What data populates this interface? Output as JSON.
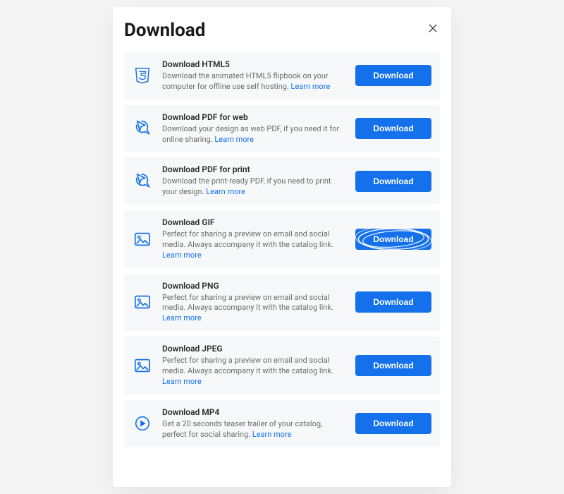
{
  "modal": {
    "title": "Download",
    "options": [
      {
        "icon": "html5-icon",
        "title": "Download HTML5",
        "desc": "Download the animated HTML5 flipbook on your computer for offline use self hosting.",
        "learn": "Learn more",
        "button": "Download",
        "highlight": false
      },
      {
        "icon": "pdf-icon",
        "title": "Download PDF for web",
        "desc": "Download your design as web PDF, if you need it for online sharing.",
        "learn": "Learn more",
        "button": "Download",
        "highlight": false
      },
      {
        "icon": "pdf-icon",
        "title": "Download PDF for print",
        "desc": "Download the print-ready PDF, if you need to print your design.",
        "learn": "Learn more",
        "button": "Download",
        "highlight": false
      },
      {
        "icon": "image-icon",
        "title": "Download GIF",
        "desc": "Perfect for sharing a preview on email and social media. Always accompany it with the catalog link.",
        "learn": "Learn more",
        "button": "Download",
        "highlight": true
      },
      {
        "icon": "image-icon",
        "title": "Download PNG",
        "desc": "Perfect for sharing a preview on email and social media. Always accompany it with the catalog link.",
        "learn": "Learn more",
        "button": "Download",
        "highlight": false
      },
      {
        "icon": "image-icon",
        "title": "Download JPEG",
        "desc": "Perfect for sharing a preview on email and social media. Always accompany it with the catalog link.",
        "learn": "Learn more",
        "button": "Download",
        "highlight": false
      },
      {
        "icon": "play-icon",
        "title": "Download MP4",
        "desc": "Get a 20 seconds teaser trailer of your catalog, perfect for social sharing.",
        "learn": "Learn more",
        "button": "Download",
        "highlight": false
      }
    ]
  }
}
